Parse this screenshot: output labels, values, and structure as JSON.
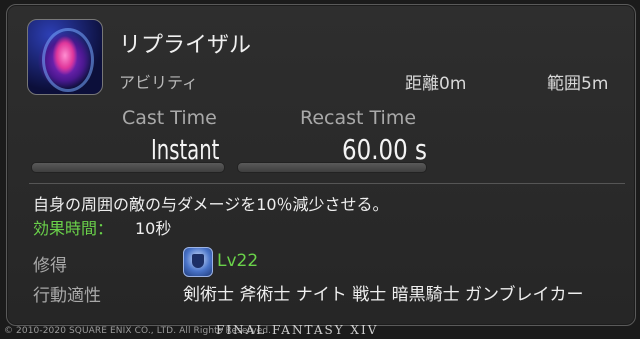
{
  "action": {
    "name": "リプライザル",
    "type": "アビリティ",
    "range": "距離0m",
    "radius": "範囲5m",
    "icon": "reprisal-action-icon"
  },
  "timing": {
    "cast_label": "Cast Time",
    "recast_label": "Recast Time",
    "cast_value": "Instant",
    "recast_value": "60.00 s"
  },
  "description": {
    "text": "自身の周囲の敵の与ダメージを10％減少させる。",
    "effect_label": "効果時間：",
    "effect_value": "10秒"
  },
  "acquire": {
    "label": "修得",
    "level": "Lv22",
    "icon": "role-shield-icon"
  },
  "jobs": {
    "label": "行動適性",
    "text": "剣術士 斧術士 ナイト 戦士 暗黒騎士 ガンブレイカー"
  },
  "footer": {
    "copyright": "© 2010-2020 SQUARE ENIX CO., LTD. All Rights Reserved.",
    "logo": "FINAL FANTASY XIV"
  },
  "colors": {
    "accent_green": "#6ad24a",
    "panel_bg": "#2a2a2a"
  }
}
